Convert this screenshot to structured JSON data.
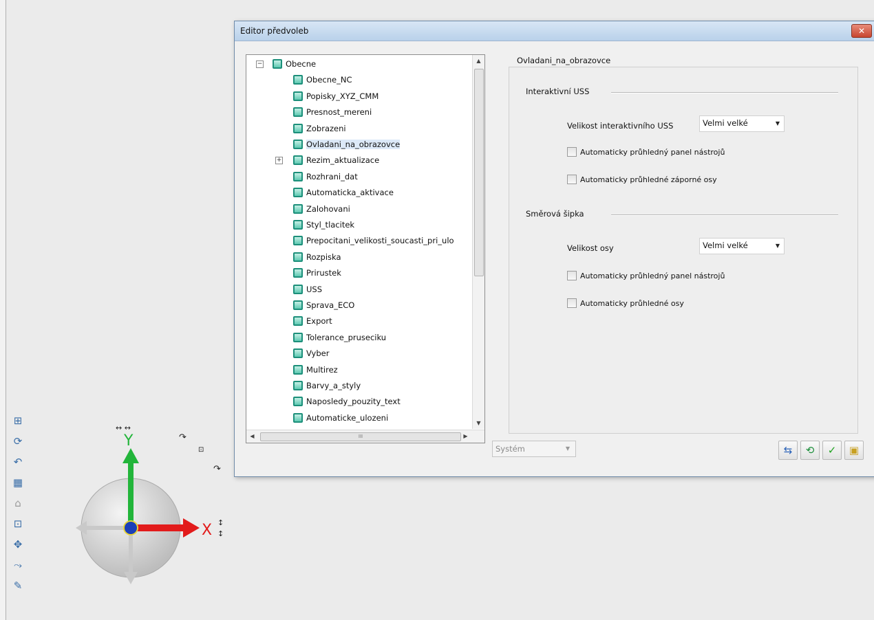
{
  "dialog": {
    "title": "Editor předvoleb",
    "close_label": "✕"
  },
  "tree": {
    "items": [
      {
        "label": "Obecne",
        "expander": "−"
      },
      {
        "label": "Obecne_NC"
      },
      {
        "label": "Popisky_XYZ_CMM"
      },
      {
        "label": "Presnost_mereni"
      },
      {
        "label": "Zobrazeni"
      },
      {
        "label": "Ovladani_na_obrazovce",
        "selected": true
      },
      {
        "label": "Rezim_aktualizace",
        "expander": "+"
      },
      {
        "label": "Rozhrani_dat"
      },
      {
        "label": "Automaticka_aktivace"
      },
      {
        "label": "Zalohovani"
      },
      {
        "label": "Styl_tlacitek"
      },
      {
        "label": "Prepocitani_velikosti_soucasti_pri_ulo"
      },
      {
        "label": "Rozpiska"
      },
      {
        "label": "Prirustek"
      },
      {
        "label": "USS"
      },
      {
        "label": "Sprava_ECO"
      },
      {
        "label": "Export"
      },
      {
        "label": "Tolerance_pruseciku"
      },
      {
        "label": "Vyber"
      },
      {
        "label": "Multirez"
      },
      {
        "label": "Barvy_a_styly"
      },
      {
        "label": "Naposledy_pouzity_text"
      },
      {
        "label": "Automaticke_ulozeni"
      }
    ],
    "hscroll_grip": "III"
  },
  "panel": {
    "title": "Ovladani_na_obrazovce",
    "group1": {
      "label": "Interaktivní USS",
      "size_label": "Velikost interaktivního USS",
      "size_value": "Velmi velké",
      "check1": "Automaticky průhledný panel nástrojů",
      "check2": "Automaticky průhledné záporné osy"
    },
    "group2": {
      "label": "Směrová šipka",
      "size_label": "Velikost osy",
      "size_value": "Velmi velké",
      "check1": "Automaticky průhledný panel nástrojů",
      "check2": "Automaticky průhledné osy"
    }
  },
  "footer": {
    "scope_value": "Systém"
  },
  "triad": {
    "y_label": "Y",
    "x_label": "X",
    "y_color": "#22b53a",
    "x_color": "#e21b1b",
    "center_color": "#1c3fb8"
  },
  "toolbar": {
    "icons": [
      "view-icon",
      "rotate-icon",
      "undo-rotate-icon",
      "grid-icon",
      "home-icon",
      "lock-icon",
      "move-icon",
      "align-icon",
      "point-icon"
    ]
  }
}
